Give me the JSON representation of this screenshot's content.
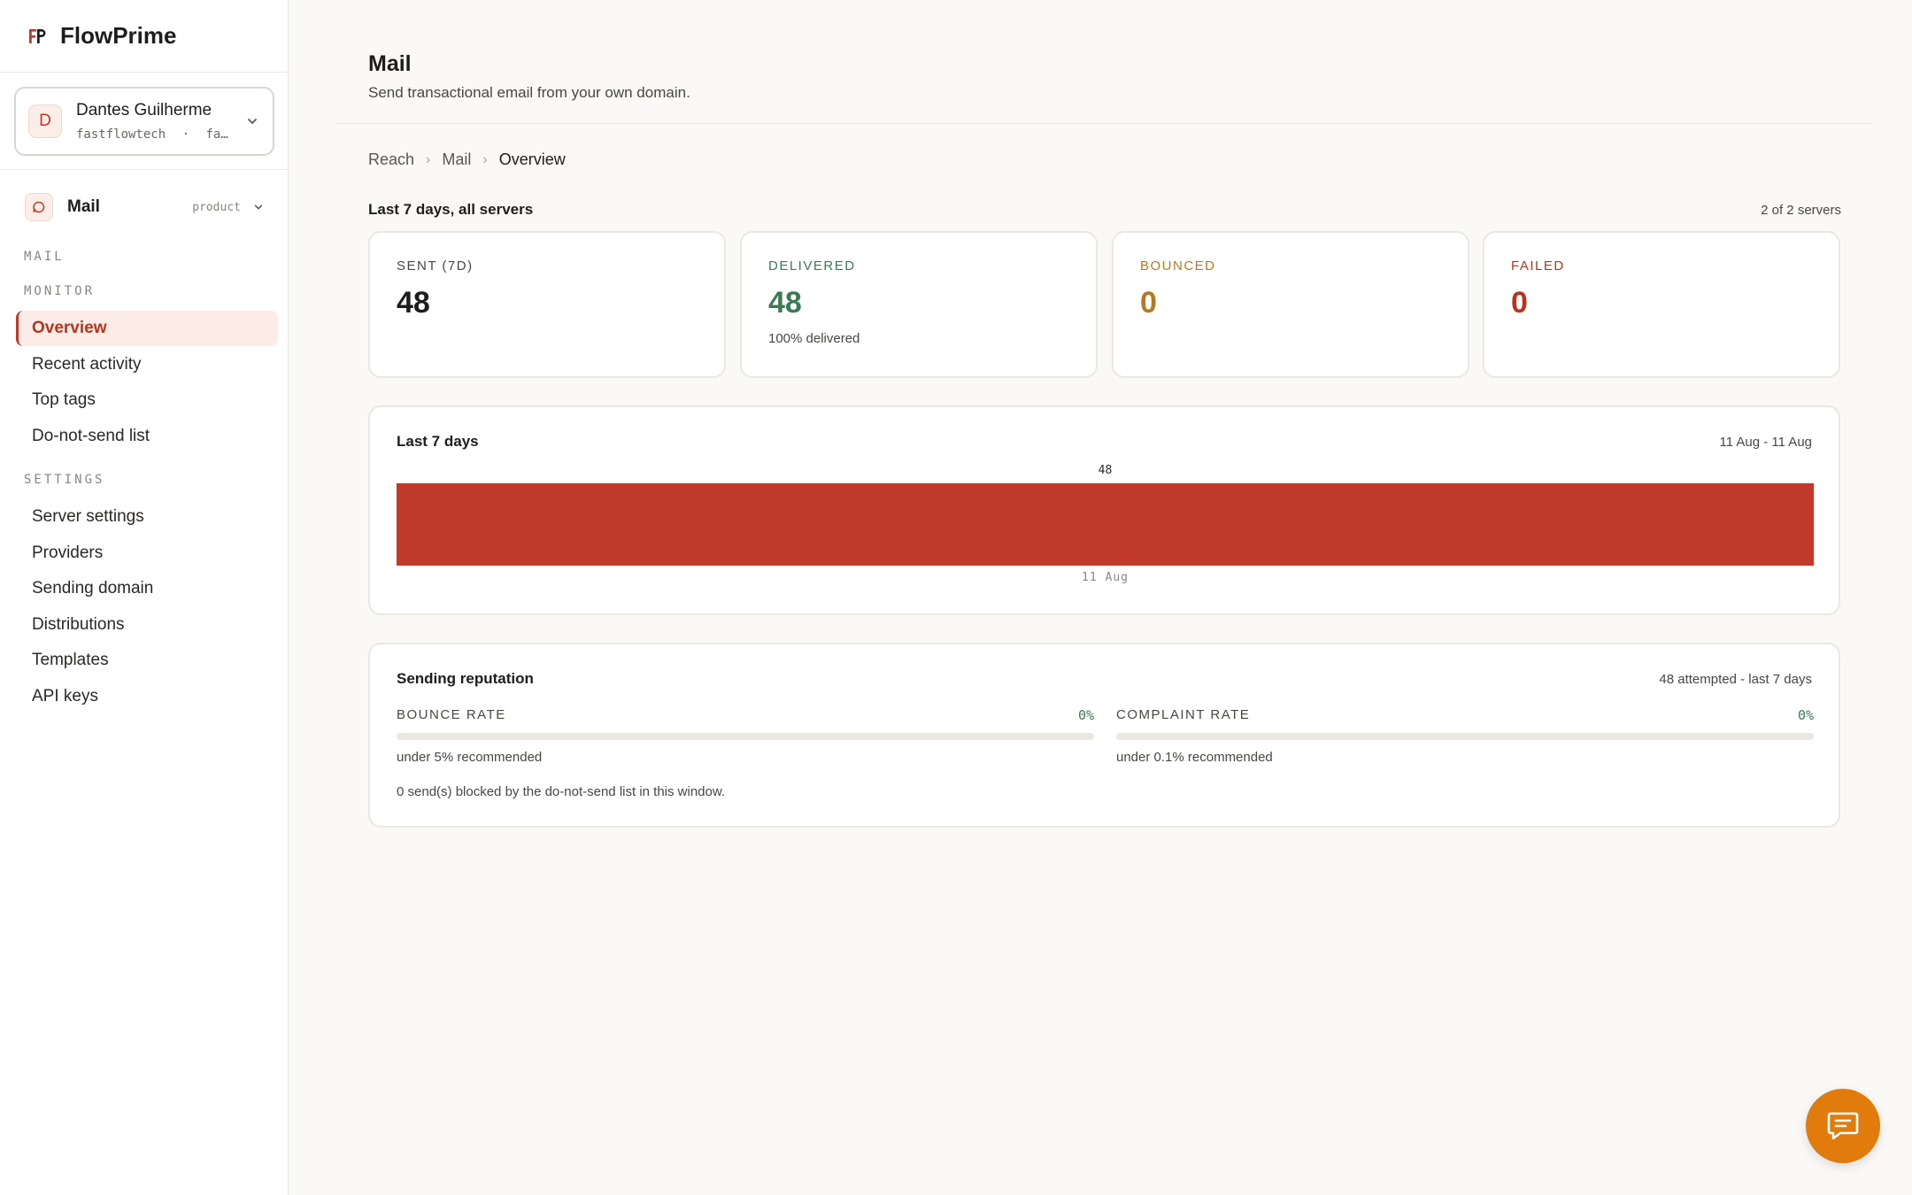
{
  "brand": {
    "name": "FlowPrime"
  },
  "account": {
    "initial": "D",
    "name": "Dantes Guilherme",
    "org": "fastflowtech",
    "separator": "·",
    "suffix": "fa…"
  },
  "product": {
    "name": "Mail",
    "tag": "product"
  },
  "sidebar": {
    "sections": {
      "mail": "MAIL",
      "monitor": "MONITOR",
      "settings": "SETTINGS"
    },
    "monitor_items": [
      {
        "label": "Overview"
      },
      {
        "label": "Recent activity"
      },
      {
        "label": "Top tags"
      },
      {
        "label": "Do-not-send list"
      }
    ],
    "settings_items": [
      {
        "label": "Server settings"
      },
      {
        "label": "Providers"
      },
      {
        "label": "Sending domain"
      },
      {
        "label": "Distributions"
      },
      {
        "label": "Templates"
      },
      {
        "label": "API keys"
      }
    ]
  },
  "header": {
    "title": "Mail",
    "subtitle": "Send transactional email from your own domain."
  },
  "breadcrumb": [
    "Reach",
    "Mail",
    "Overview"
  ],
  "summary": {
    "range_label": "Last 7 days, all servers",
    "servers_count": "2 of 2 servers"
  },
  "stats": [
    {
      "label": "SENT (7D)",
      "value": "48",
      "note": "",
      "color": "#1f1d1b"
    },
    {
      "label": "DELIVERED",
      "value": "48",
      "note": "100% delivered",
      "color": "#3c7a57"
    },
    {
      "label": "BOUNCED",
      "value": "0",
      "note": "",
      "color": "#b7791f"
    },
    {
      "label": "FAILED",
      "value": "0",
      "note": "",
      "color": "#b7351f"
    }
  ],
  "chart_card": {
    "title": "Last 7 days",
    "range": "11 Aug - 11 Aug"
  },
  "chart_data": {
    "type": "bar",
    "categories": [
      "11 Aug"
    ],
    "values": [
      48
    ],
    "ylim": [
      0,
      48
    ],
    "color": "#c0392b"
  },
  "reputation": {
    "title": "Sending reputation",
    "meta": "48 attempted - last 7 days",
    "bounce": {
      "label": "BOUNCE RATE",
      "value": "0%",
      "fraction": 0,
      "note": "under 5% recommended"
    },
    "complaint": {
      "label": "COMPLAINT RATE",
      "value": "0%",
      "fraction": 0,
      "note": "under 0.1% recommended"
    },
    "blocked_note": "0 send(s) blocked by the do-not-send list in this window."
  },
  "icons": {
    "brand": "flowprime-logo-icon",
    "account_chevron": "chevron-down-icon",
    "product": "chat-bubble-icon",
    "product_chevron": "chevron-down-icon",
    "chat": "chat-message-icon"
  },
  "colors": {
    "accent": "#c0392b",
    "chat": "#e07b0c",
    "success": "#3c7a57",
    "warning": "#b7791f"
  }
}
